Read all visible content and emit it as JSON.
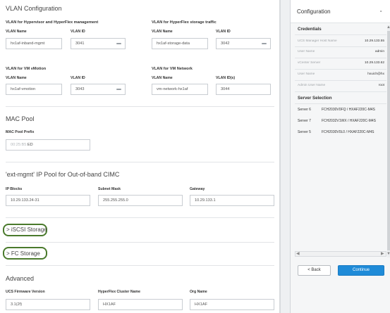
{
  "vlan": {
    "title": "VLAN Configuration",
    "hx_mgmt": {
      "title": "VLAN for Hypervisor and HyperFlex management",
      "name_label": "VLAN Name",
      "name_value": "hx1af-inband-mgmt",
      "id_label": "VLAN ID",
      "id_value": "3041"
    },
    "hx_storage": {
      "title": "VLAN for HyperFlex storage traffic",
      "name_label": "VLAN Name",
      "name_value": "hx1af-storage-data",
      "id_label": "VLAN ID",
      "id_value": "3042"
    },
    "vmotion": {
      "title": "VLAN for VM vMotion",
      "name_label": "VLAN Name",
      "name_value": "hx1af-vmotion",
      "id_label": "VLAN ID",
      "id_value": "3043"
    },
    "vm_network": {
      "title": "VLAN for VM Network",
      "name_label": "VLAN Name",
      "name_value": "vm-network-hx1af",
      "id_label": "VLAN ID(s)",
      "id_value": "3044"
    }
  },
  "mac_pool": {
    "title": "MAC Pool",
    "prefix_label": "MAC Pool Prefix",
    "prefix_fixed": "00:25:B5:",
    "prefix_value": "ED"
  },
  "ip_pool": {
    "title": "'ext-mgmt' IP Pool for Out-of-band CIMC",
    "blocks_label": "IP Blocks",
    "blocks_value": "10.29.133.24-31",
    "mask_label": "Subnet Mask",
    "mask_value": "255.255.255.0",
    "gateway_label": "Gateway",
    "gateway_value": "10.29.133.1"
  },
  "iscsi": {
    "label": "> iSCSI Storage"
  },
  "fc": {
    "label": "> FC Storage"
  },
  "advanced": {
    "title": "Advanced",
    "fw_label": "UCS Firmware Version",
    "fw_value": "3.1(2f)",
    "cluster_label": "HyperFlex Cluster Name",
    "cluster_value": "HX1AF",
    "org_label": "Org Name",
    "org_value": "HX1AF"
  },
  "panel": {
    "title": "Configuration",
    "pin_icon": "pin-icon",
    "credentials_title": "Credentials",
    "credentials": [
      {
        "label": "UCS Manager Host Name",
        "value": "10.29.133.55"
      },
      {
        "label": "User Name",
        "value": "admin"
      },
      {
        "label": "vCenter Server",
        "value": "10.29.133.62"
      },
      {
        "label": "User Name",
        "value": "hxuich@hx"
      },
      {
        "label": "Admin User Name",
        "value": "root"
      }
    ],
    "servers_title": "Server Selection",
    "servers": [
      {
        "name": "Server 6",
        "id": "FCH2030V0FQ / HXAF220C-M4S"
      },
      {
        "name": "Server 7",
        "id": "FCH2032V1WX / HXAF220C-M4S"
      },
      {
        "name": "Server 5",
        "id": "FCH2030V0L0 / HXAF220C-M4S"
      }
    ],
    "back_label": "< Back",
    "continue_label": "Continue"
  },
  "colors": {
    "accent": "#1f8bd8",
    "highlight_oval": "#4a7a2c"
  }
}
